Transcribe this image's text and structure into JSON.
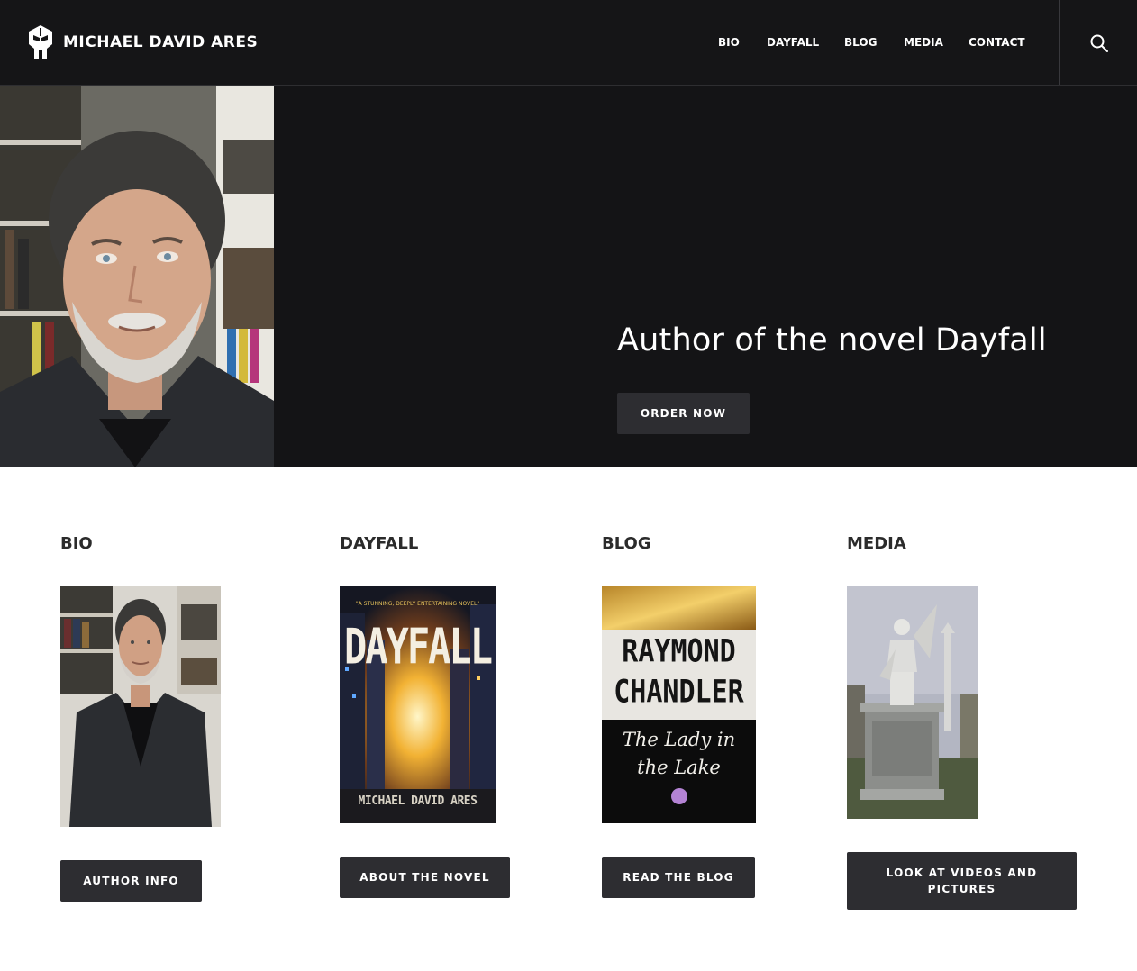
{
  "site": {
    "name": "MICHAEL DAVID ARES"
  },
  "nav": {
    "items": [
      {
        "label": "BIO"
      },
      {
        "label": "DAYFALL"
      },
      {
        "label": "BLOG"
      },
      {
        "label": "MEDIA"
      },
      {
        "label": "CONTACT"
      }
    ],
    "search_icon": "search-icon"
  },
  "hero": {
    "title": "Author of the novel Dayfall",
    "cta_label": "ORDER NOW",
    "photo": "author-portrait"
  },
  "sections": [
    {
      "title": "BIO",
      "image": "author-full-photo",
      "button_label": "AUTHOR INFO"
    },
    {
      "title": "DAYFALL",
      "image": "dayfall-book-cover",
      "button_label": "ABOUT THE NOVEL",
      "cover": {
        "top_quote": "\"A STUNNING, DEEPLY ENTERTAINING NOVEL\"",
        "title": "DAYFALL",
        "author": "MICHAEL DAVID ARES"
      }
    },
    {
      "title": "BLOG",
      "image": "lady-in-the-lake-cover",
      "button_label": "READ THE BLOG",
      "cover": {
        "line1": "RAYMOND",
        "line2": "CHANDLER",
        "sub1": "The Lady in",
        "sub2": "the Lake"
      }
    },
    {
      "title": "MEDIA",
      "image": "cemetery-angel-photo",
      "button_label": "LOOK AT VIDEOS AND PICTURES"
    }
  ],
  "colors": {
    "header_bg": "#151517",
    "hero_bg": "#141416",
    "button_bg": "#2d2d31",
    "text_dark": "#2b2b2b"
  }
}
